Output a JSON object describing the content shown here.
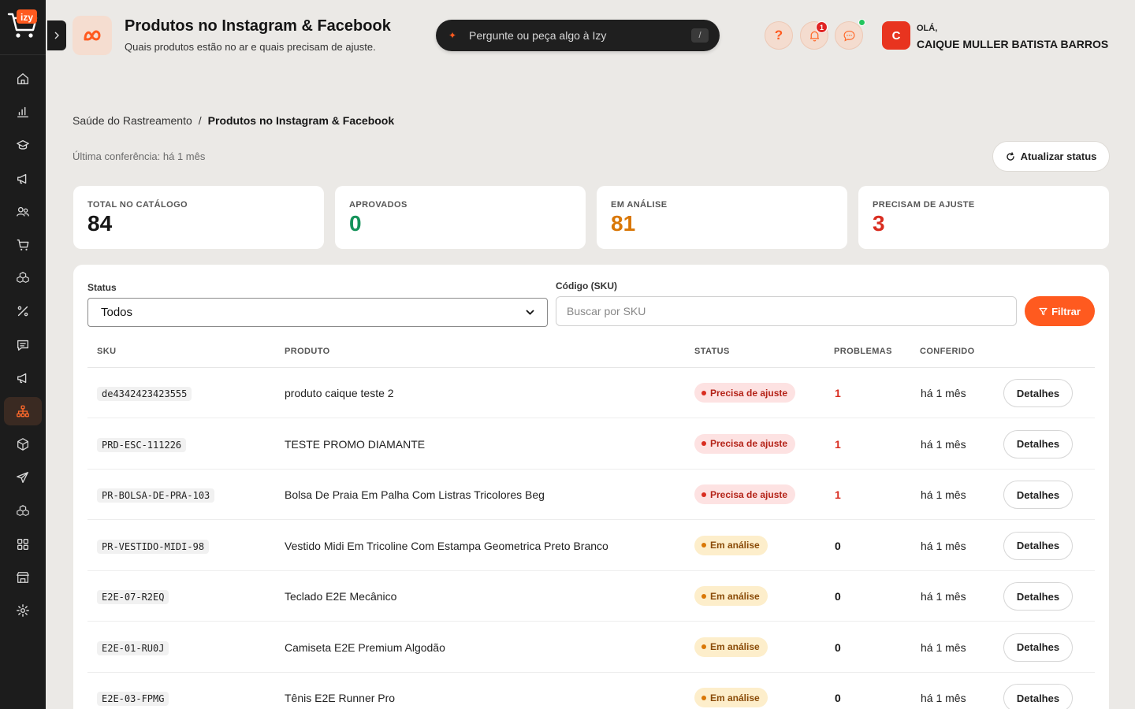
{
  "brand": {
    "logo_text": "izy",
    "accent": "#ff5a1f"
  },
  "sidebar": {
    "items": [
      {
        "name": "home-icon"
      },
      {
        "name": "chart-icon"
      },
      {
        "name": "graduation-icon"
      },
      {
        "name": "megaphone-icon"
      },
      {
        "name": "users-icon"
      },
      {
        "name": "cart-icon"
      },
      {
        "name": "boxes-icon"
      },
      {
        "name": "percent-icon"
      },
      {
        "name": "message-icon"
      },
      {
        "name": "megaphone-icon"
      },
      {
        "name": "sitemap-icon",
        "active": true
      },
      {
        "name": "box-icon"
      },
      {
        "name": "send-icon"
      },
      {
        "name": "boxes-icon"
      },
      {
        "name": "grid-icon"
      },
      {
        "name": "store-icon"
      },
      {
        "name": "gear-icon"
      }
    ]
  },
  "header": {
    "title": "Produtos no Instagram & Facebook",
    "subtitle": "Quais produtos estão no ar e quais precisam de ajuste.",
    "ask_placeholder": "Pergunte ou peça algo à Izy",
    "ask_shortcut": "/",
    "help_label": "?",
    "notifications_count": "1",
    "user": {
      "initial": "C",
      "greeting": "OLÁ,",
      "name": "CAIQUE MULLER BATISTA BARROS"
    }
  },
  "breadcrumb": {
    "parent": "Saúde do Rastreamento",
    "separator": "/",
    "current": "Produtos no Instagram & Facebook"
  },
  "last_check": "Última conferência: há 1 mês",
  "refresh_label": "Atualizar status",
  "stats": [
    {
      "label": "TOTAL NO CATÁLOGO",
      "value": "84",
      "color": "#151515"
    },
    {
      "label": "APROVADOS",
      "value": "0",
      "color": "#15935a"
    },
    {
      "label": "EM ANÁLISE",
      "value": "81",
      "color": "#d97706"
    },
    {
      "label": "PRECISAM DE AJUSTE",
      "value": "3",
      "color": "#d92d20"
    }
  ],
  "filters": {
    "status_label": "Status",
    "status_value": "Todos",
    "sku_label": "Código (SKU)",
    "sku_placeholder": "Buscar por SKU",
    "filter_button": "Filtrar"
  },
  "table": {
    "headers": {
      "sku": "SKU",
      "product": "PRODUTO",
      "status": "STATUS",
      "problems": "PROBLEMAS",
      "checked": "CONFERIDO"
    },
    "details_label": "Detalhes",
    "rows": [
      {
        "sku": "de4342423423555",
        "product": "produto caique teste 2",
        "status": "Precisa de ajuste",
        "kind": "bad",
        "problems": "1",
        "checked": "há 1 mês"
      },
      {
        "sku": "PRD-ESC-111226",
        "product": "TESTE PROMO DIAMANTE",
        "status": "Precisa de ajuste",
        "kind": "bad",
        "problems": "1",
        "checked": "há 1 mês"
      },
      {
        "sku": "PR-BOLSA-DE-PRA-103",
        "product": "Bolsa De Praia Em Palha Com Listras Tricolores Beg",
        "status": "Precisa de ajuste",
        "kind": "bad",
        "problems": "1",
        "checked": "há 1 mês"
      },
      {
        "sku": "PR-VESTIDO-MIDI-98",
        "product": "Vestido Midi Em Tricoline Com Estampa Geometrica Preto Branco",
        "status": "Em análise",
        "kind": "review",
        "problems": "0",
        "checked": "há 1 mês"
      },
      {
        "sku": "E2E-07-R2EQ",
        "product": "Teclado E2E Mecânico",
        "status": "Em análise",
        "kind": "review",
        "problems": "0",
        "checked": "há 1 mês"
      },
      {
        "sku": "E2E-01-RU0J",
        "product": "Camiseta E2E Premium Algodão",
        "status": "Em análise",
        "kind": "review",
        "problems": "0",
        "checked": "há 1 mês"
      },
      {
        "sku": "E2E-03-FPMG",
        "product": "Tênis E2E Runner Pro",
        "status": "Em análise",
        "kind": "review",
        "problems": "0",
        "checked": "há 1 mês"
      }
    ]
  }
}
